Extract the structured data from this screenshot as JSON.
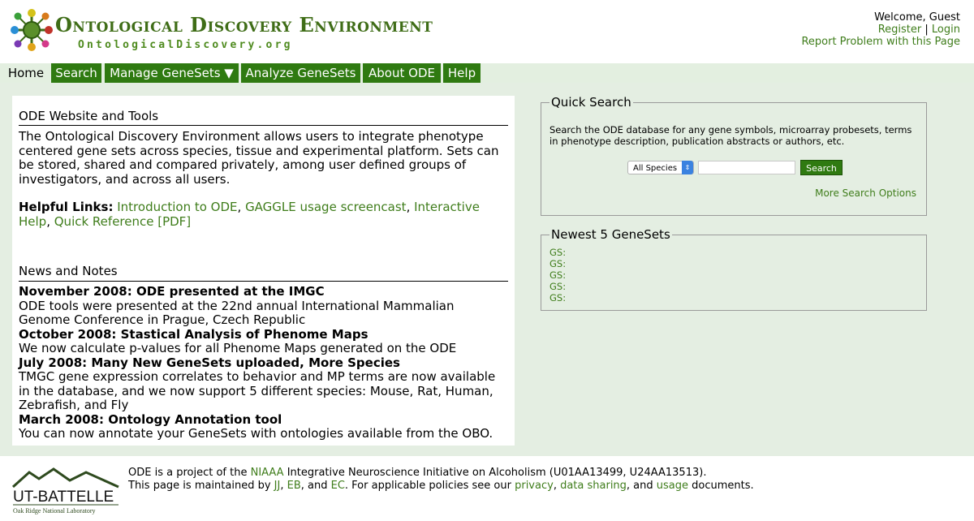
{
  "header": {
    "title": "Ontological Discovery Environment",
    "subtitle": "OntologicalDiscovery.org",
    "welcome": "Welcome, Guest",
    "register": "Register",
    "separator": "|",
    "login": "Login",
    "report": "Report Problem with this Page"
  },
  "nav": {
    "home": "Home",
    "search": "Search",
    "manage": "Manage GeneSets ▼",
    "analyze": "Analyze GeneSets",
    "about": "About ODE",
    "help": "Help"
  },
  "left": {
    "website_heading": "ODE Website and Tools",
    "intro": "The Ontological Discovery Environment allows users to integrate phenotype centered gene sets across species, tissue and experimental platform. Sets can be stored, shared and compared privately, among user defined groups of investigators, and across all users.",
    "helpful_label": "Helpful Links:",
    "links": [
      "Introduction to ODE",
      "GAGGLE usage screencast",
      "Interactive Help",
      "Quick Reference [PDF]"
    ],
    "news_heading": "News and Notes",
    "news": [
      {
        "title": "November 2008: ODE presented at the IMGC",
        "body": "ODE tools were presented at the 22nd annual International Mammalian Genome Conference in Prague, Czech Republic"
      },
      {
        "title": "October 2008: Stastical Analysis of Phenome Maps",
        "body": "We now calculate p-values for all Phenome Maps generated on the ODE"
      },
      {
        "title": "July 2008: Many New GeneSets uploaded, More Species",
        "body": "TMGC gene expression correlates to behavior and MP terms are now available in the database, and we now support 5 different species: Mouse, Rat, Human, Zebrafish, and Fly"
      },
      {
        "title": "March 2008: Ontology Annotation tool",
        "body": "You can now annotate your GeneSets with ontologies available from the OBO."
      }
    ]
  },
  "quick_search": {
    "legend": "Quick Search",
    "description": "Search the ODE database for any gene symbols, microarray probesets, terms in phenotype description, publication abstracts or authors, etc.",
    "species_selected": "All Species",
    "query_value": "",
    "button": "Search",
    "more": "More Search Options"
  },
  "newest": {
    "legend": "Newest 5 GeneSets",
    "items": [
      "GS:",
      "GS:",
      "GS:",
      "GS:",
      "GS:"
    ]
  },
  "footer": {
    "logo_text": "UT-BATTELLE",
    "logo_sub": "Oak Ridge National Laboratory",
    "l1_a": "ODE is a project of the ",
    "l1_link": "NIAAA",
    "l1_b": " Integrative Neuroscience Initiative on Alcoholism (U01AA13499, U24AA13513).",
    "l2_a": "This page is maintained by ",
    "jj": "JJ",
    "c1": ", ",
    "eb": "EB",
    "and": ", and ",
    "ec": "EC",
    "l2_b": ". For applicable policies see our ",
    "privacy": "privacy",
    "c2": ", ",
    "sharing": "data sharing",
    "and2": ", and ",
    "usage": "usage",
    "l2_c": " documents."
  },
  "colors": {
    "brand_green": "#2f7a11",
    "link_green": "#3f7d1b",
    "panel_bg": "#e4eee2"
  }
}
